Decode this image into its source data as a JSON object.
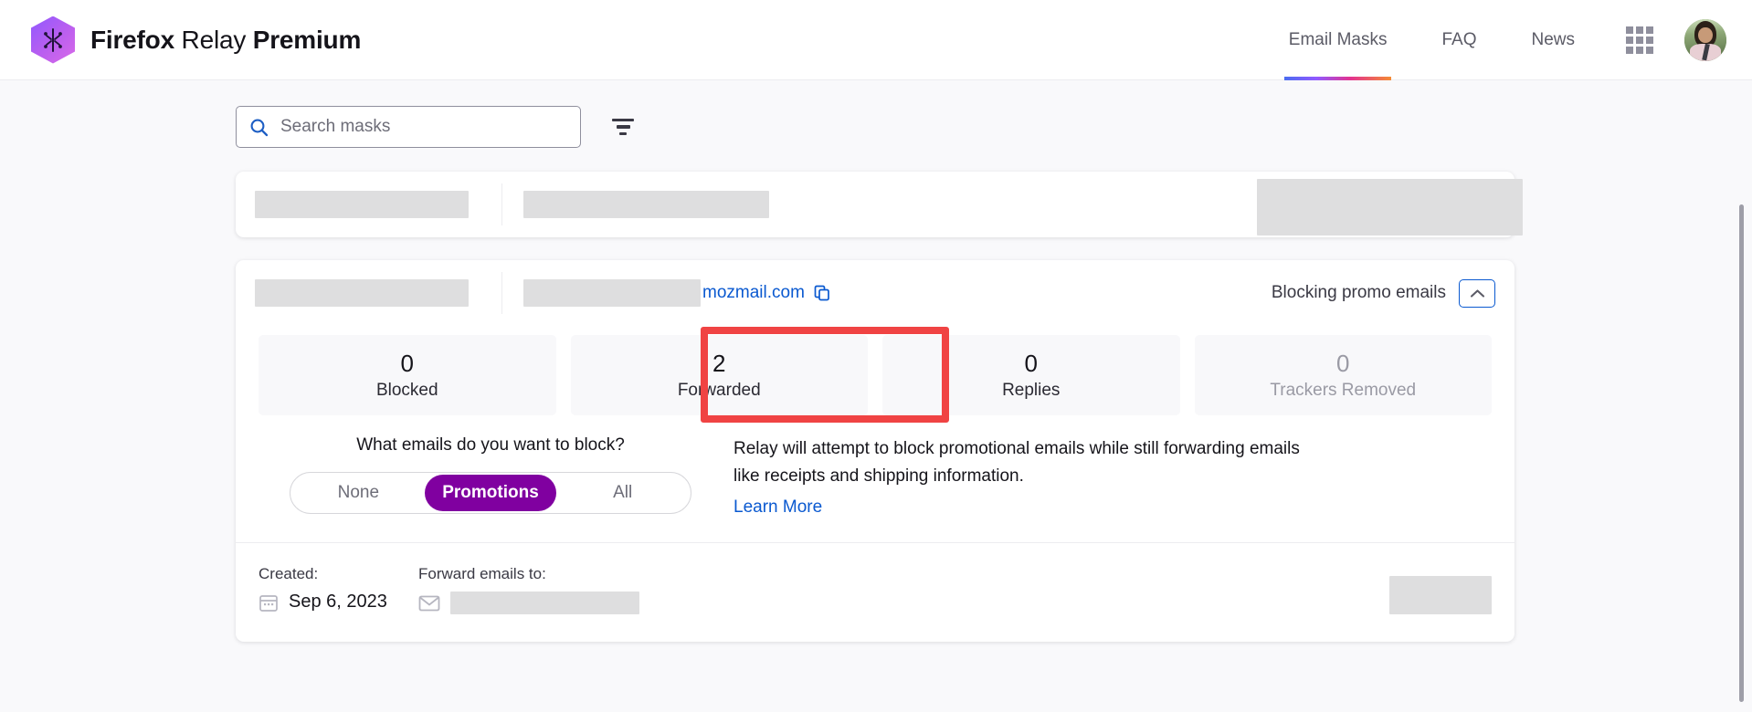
{
  "header": {
    "brand": {
      "word1": "Firefox",
      "word2": "Relay",
      "word3": "Premium"
    },
    "logo_icon": "firefox-relay-logo-icon",
    "nav": [
      {
        "label": "Email Masks",
        "active": true
      },
      {
        "label": "FAQ",
        "active": false
      },
      {
        "label": "News",
        "active": false
      }
    ],
    "apps_icon": "apps-grid-icon",
    "avatar": "user-avatar"
  },
  "toolbar": {
    "search_placeholder": "Search masks",
    "search_value": "",
    "search_icon": "search-icon",
    "filter_icon": "filter-icon",
    "redacted_block": ""
  },
  "cards": {
    "collapsed": {
      "label_redacted": "",
      "address_redacted": "",
      "status_redacted": ""
    },
    "expanded": {
      "label_redacted": "",
      "address_redacted": "",
      "address_domain": "mozmail.com",
      "copy_icon": "copy-icon",
      "block_status": "Blocking promo emails",
      "chevron_icon": "chevron-up-icon",
      "stats": [
        {
          "value": "0",
          "label": "Blocked",
          "dim": false,
          "highlighted": false
        },
        {
          "value": "2",
          "label": "Forwarded",
          "dim": false,
          "highlighted": true
        },
        {
          "value": "0",
          "label": "Replies",
          "dim": false,
          "highlighted": false
        },
        {
          "value": "0",
          "label": "Trackers Removed",
          "dim": true,
          "highlighted": false
        }
      ],
      "block_question": "What emails do you want to block?",
      "block_options": [
        {
          "label": "None",
          "selected": false
        },
        {
          "label": "Promotions",
          "selected": true
        },
        {
          "label": "All",
          "selected": false
        }
      ],
      "description": "Relay will attempt to block promotional emails while still forwarding emails like receipts and shipping information.",
      "learn_more": "Learn More",
      "created_title": "Created:",
      "created_icon": "calendar-icon",
      "created_value": "Sep 6, 2023",
      "forward_title": "Forward emails to:",
      "forward_icon": "envelope-icon",
      "forward_redacted": "",
      "meta_right_redacted": ""
    }
  },
  "colors": {
    "accent_purple": "#8000a0",
    "link_blue": "#0a59d0",
    "highlight_red": "#f04343",
    "redaction_gray": "#dededf"
  }
}
